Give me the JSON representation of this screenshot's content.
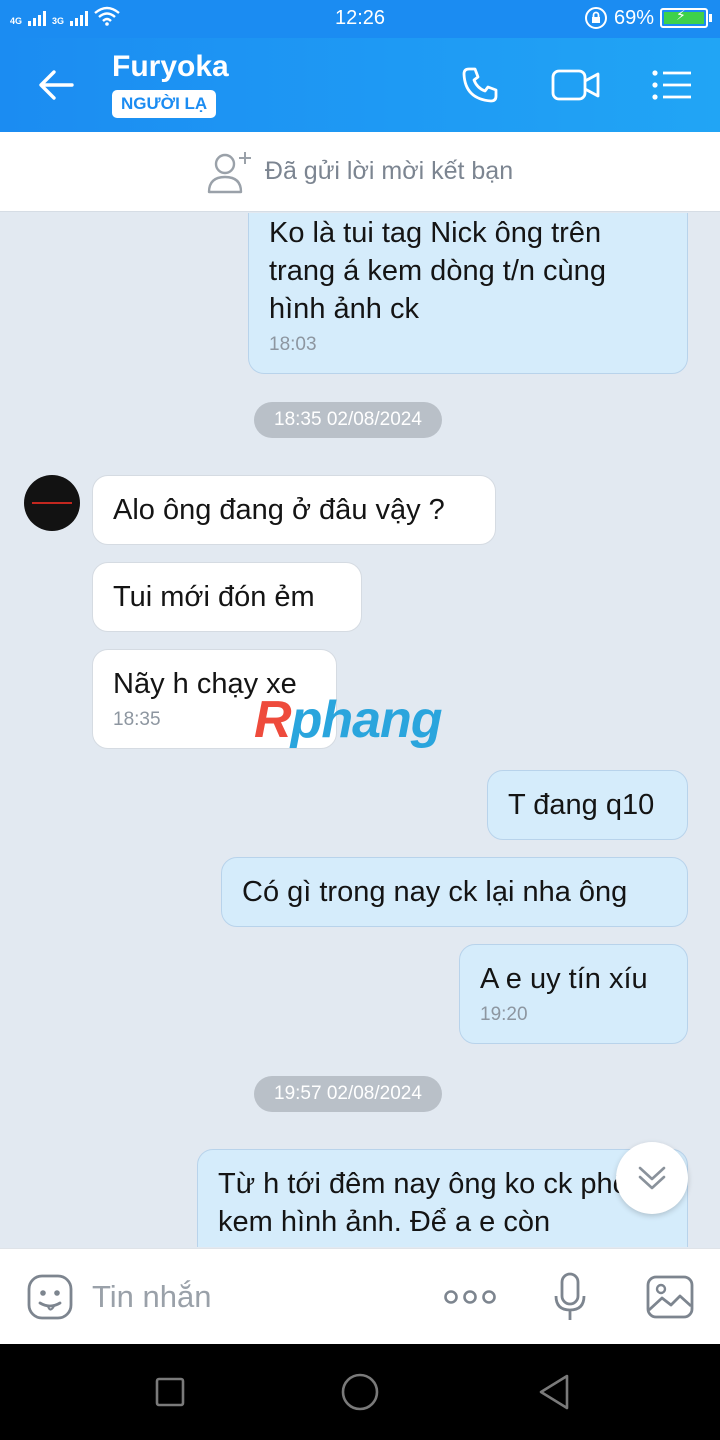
{
  "status_bar": {
    "network1": "4G",
    "network2": "3G",
    "time": "12:26",
    "battery": "69%"
  },
  "header": {
    "title": "Furyoka",
    "badge": "NGƯỜI LẠ"
  },
  "friend_request": {
    "text": "Đã gửi lời mời kết bạn"
  },
  "messages": [
    {
      "text": "Ko là tui  tag Nick  ông trên trang  á kem dòng t/n  cùng hình ảnh ck",
      "time": "18:03",
      "from": "me"
    },
    {
      "date": "18:35 02/08/2024"
    },
    {
      "text": "Alo ông đang ở đâu vậy ?",
      "from": "them"
    },
    {
      "text": "Tui mới đón ẻm",
      "from": "them"
    },
    {
      "text": "Nãy h chạy xe",
      "time": "18:35",
      "from": "them"
    },
    {
      "text": "T đang q10",
      "from": "me"
    },
    {
      "text": "Có gì trong nay ck lại nha ông",
      "from": "me"
    },
    {
      "text": "A e uy tín xíu",
      "time": "19:20",
      "from": "me"
    },
    {
      "date": "19:57 02/08/2024"
    },
    {
      "text": "Từ h tới đêm nay  ông  ko ck phốt kem hình ảnh. Để a e còn",
      "from": "me"
    }
  ],
  "watermark": {
    "first": "R",
    "rest": "phang"
  },
  "input": {
    "placeholder": "Tin nhắn"
  },
  "colors": {
    "header": "#1b8cf2",
    "bubble_me": "#d5ecfb",
    "bubble_them": "#ffffff",
    "chat_bg": "#e2e9f1"
  }
}
